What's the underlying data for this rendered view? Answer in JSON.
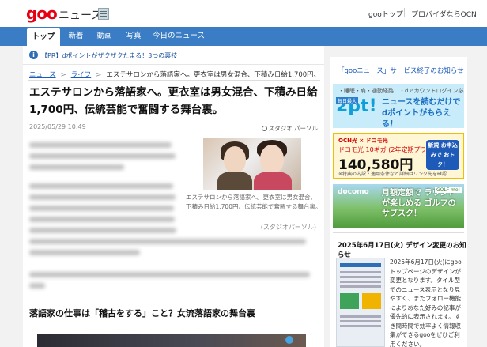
{
  "header": {
    "logo": "goo",
    "site_name": "ニュース",
    "links": [
      "gooトップ",
      "プロバイダならOCN"
    ]
  },
  "nav": {
    "tabs": [
      "トップ",
      "新着",
      "動画",
      "写真",
      "今日のニュース"
    ],
    "active_tab": "トップ"
  },
  "promo": {
    "icon": "info-icon",
    "text": "【PR】dポイントがザクザクたまる！3つの裏技"
  },
  "breadcrumb": {
    "items": [
      "ニュース",
      "ライフ",
      "エステサロンから落語家へ。更衣室は男女混合、下積み日給1,700円、伝統..."
    ]
  },
  "article": {
    "title": "エステサロンから落語家へ。更衣室は男女混合、下積み日給1,700円、伝統芸能で奮闘する舞台裏。",
    "date": "2025/05/29 10:49",
    "source": "スタジオ パーソル",
    "image_caption": "エステサロンから落語家へ。更衣室は男女混合、下積み日給1,700円、伝統芸能で奮闘する舞台裏。",
    "image_credit": "(スタジオパーソル)",
    "subheading": "落語家の仕事は「稽古をする」こと？女流落語家の舞台裏"
  },
  "sidebar": {
    "notice_link": "「gooニュース」サービス終了のお知らせ",
    "banners": [
      {
        "name": "d-point-banner",
        "tagline": "・睡眠・肩・通勤経路　・dアカウントログイン必須",
        "badge": "毎日最大",
        "big": "2pt!",
        "copy": "ニュースを読むだけで dポイントがもらえる！"
      },
      {
        "name": "ocn-docomo-banner",
        "brand": "OCN光 × ドコモ光",
        "offer": "ドコモ光 10ギガ (2年定期プラン)",
        "amount": "140,580円",
        "note": "※特典の内訳・適用条件など詳細はリンク先を確認",
        "cta": "新規 お申込みで おトク！"
      },
      {
        "name": "golf-banner",
        "brand": "docomo",
        "copy": "月額定額で ラウンドが楽しめる ゴルフのサブスク！",
        "partner": "GOLF me!"
      }
    ],
    "design_notice": {
      "title": "2025年6月17日(火) デザイン変更のお知らせ",
      "body": "2025年6月17日(火)にgooトップページのデザインが変更となります。タイル型でのニュース表示となり見やすく、またフォロー機能によりあなた好みの記事が優先的に表示されます。すき間時間で効率よく情報収集ができるgooをぜひご利用ください。"
    }
  }
}
